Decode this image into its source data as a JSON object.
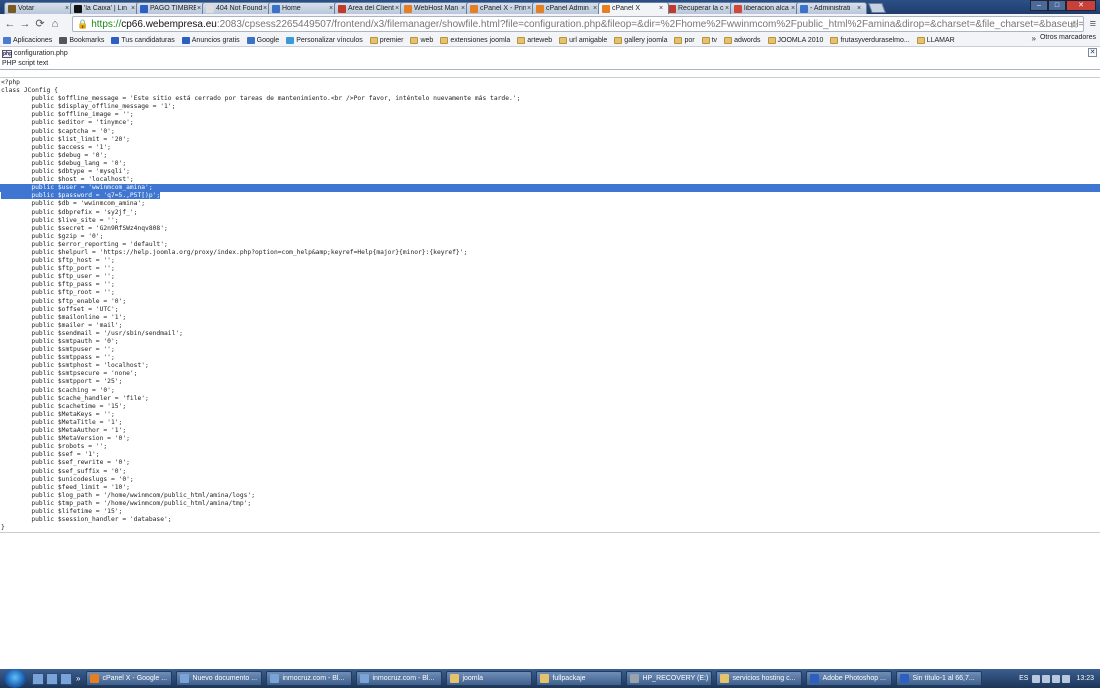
{
  "tabs": [
    {
      "label": "Votar",
      "icon_color": "#7a5a20",
      "active": false
    },
    {
      "label": "'la Caixa' | Lin",
      "icon_color": "#111111",
      "active": false
    },
    {
      "label": "PAGO TIMBRE",
      "icon_color": "#2b5fc2",
      "active": false
    },
    {
      "label": "404 Not Found",
      "icon_color": "#dddddd",
      "active": false
    },
    {
      "label": "Home",
      "icon_color": "#3a72c8",
      "active": false
    },
    {
      "label": "Área del Client",
      "icon_color": "#c0392b",
      "active": false
    },
    {
      "label": "WebHost Man",
      "icon_color": "#e67e22",
      "active": false
    },
    {
      "label": "cPanel X - Prin",
      "icon_color": "#e67e22",
      "active": false
    },
    {
      "label": "cPanel Admin",
      "icon_color": "#e67e22",
      "active": false
    },
    {
      "label": "cPanel X",
      "icon_color": "#e67e22",
      "active": true
    },
    {
      "label": "Recuperar la c",
      "icon_color": "#c0392b",
      "active": false
    },
    {
      "label": "liberacion alca",
      "icon_color": "#d44638",
      "active": false
    },
    {
      "label": "- Administrati",
      "icon_color": "#3a72c8",
      "active": false
    }
  ],
  "address": {
    "scheme": "https://",
    "host": "cp66.webempresa.eu",
    "rest": ":2083/cpsess2265449507/frontend/x3/filemanager/showfile.html?file=configuration.php&fileop=&dir=%2Fhome%2Fwwinmcom%2Fpublic_html%2Famina&dirop=&charset=&file_charset=&baseurl=&basedir="
  },
  "bookmarks": [
    {
      "label": "Aplicaciones",
      "icon": "apps-icon",
      "color": "#4a7bd0"
    },
    {
      "label": "Bookmarks",
      "icon": "star-icon",
      "color": "#555555"
    },
    {
      "label": "Tus candidaturas",
      "icon": "site-icon",
      "color": "#2b5fc2"
    },
    {
      "label": "Anuncios gratis",
      "icon": "site-icon",
      "color": "#2b5fc2"
    },
    {
      "label": "Google",
      "icon": "google-icon",
      "color": "#3a72c8"
    },
    {
      "label": "Personalizar vínculos",
      "icon": "grid-icon",
      "color": "#3a9ad9"
    },
    {
      "label": "premier",
      "icon": "folder-icon"
    },
    {
      "label": "web",
      "icon": "folder-icon"
    },
    {
      "label": "extensiones joomla",
      "icon": "folder-icon"
    },
    {
      "label": "arteweb",
      "icon": "folder-icon"
    },
    {
      "label": "url amigable",
      "icon": "folder-icon"
    },
    {
      "label": "gallery joomla",
      "icon": "folder-icon"
    },
    {
      "label": "por",
      "icon": "folder-icon"
    },
    {
      "label": "tv",
      "icon": "folder-icon"
    },
    {
      "label": "adwords",
      "icon": "folder-icon"
    },
    {
      "label": "JOOMLA 2010",
      "icon": "folder-icon"
    },
    {
      "label": "frutasyverduraselmo...",
      "icon": "folder-icon"
    },
    {
      "label": "LLAMAR",
      "icon": "folder-icon"
    }
  ],
  "bookmarks_more": "»",
  "bookmarks_other": "Otros marcadores",
  "file": {
    "name": "configuration.php",
    "type": "PHP script text"
  },
  "code_lines": [
    {
      "t": "<?php",
      "hl": "none"
    },
    {
      "t": "class JConfig {",
      "hl": "none"
    },
    {
      "t": "\tpublic $offline_message = 'Este sitio está cerrado por tareas de mantenimiento.<br />Por favor, inténtelo nuevamente más tarde.';",
      "hl": "none"
    },
    {
      "t": "\tpublic $display_offline_message = '1';",
      "hl": "none"
    },
    {
      "t": "\tpublic $offline_image = '';",
      "hl": "none"
    },
    {
      "t": "\tpublic $editor = 'tinymce';",
      "hl": "none"
    },
    {
      "t": "\tpublic $captcha = '0';",
      "hl": "none"
    },
    {
      "t": "\tpublic $list_limit = '20';",
      "hl": "none"
    },
    {
      "t": "\tpublic $access = '1';",
      "hl": "none"
    },
    {
      "t": "\tpublic $debug = '0';",
      "hl": "none"
    },
    {
      "t": "\tpublic $debug_lang = '0';",
      "hl": "none"
    },
    {
      "t": "\tpublic $dbtype = 'mysqli';",
      "hl": "none"
    },
    {
      "t": "\tpublic $host = 'localhost';",
      "hl": "none"
    },
    {
      "t": "\tpublic $user = 'wwinmcom_amina';",
      "hl": "full"
    },
    {
      "t": "\tpublic $password = 'q7=5.,P5T[)p';",
      "hl": "part"
    },
    {
      "t": "\tpublic $db = 'wwinmcom_amina';",
      "hl": "none"
    },
    {
      "t": "\tpublic $dbprefix = 'sy2jf_';",
      "hl": "none"
    },
    {
      "t": "\tpublic $live_site = '';",
      "hl": "none"
    },
    {
      "t": "\tpublic $secret = 'G2n9RfSWz4nqv808';",
      "hl": "none"
    },
    {
      "t": "\tpublic $gzip = '0';",
      "hl": "none"
    },
    {
      "t": "\tpublic $error_reporting = 'default';",
      "hl": "none"
    },
    {
      "t": "\tpublic $helpurl = 'https://help.joomla.org/proxy/index.php?option=com_help&amp;keyref=Help{major}{minor}:{keyref}';",
      "hl": "none"
    },
    {
      "t": "\tpublic $ftp_host = '';",
      "hl": "none"
    },
    {
      "t": "\tpublic $ftp_port = '';",
      "hl": "none"
    },
    {
      "t": "\tpublic $ftp_user = '';",
      "hl": "none"
    },
    {
      "t": "\tpublic $ftp_pass = '';",
      "hl": "none"
    },
    {
      "t": "\tpublic $ftp_root = '';",
      "hl": "none"
    },
    {
      "t": "\tpublic $ftp_enable = '0';",
      "hl": "none"
    },
    {
      "t": "\tpublic $offset = 'UTC';",
      "hl": "none"
    },
    {
      "t": "\tpublic $mailonline = '1';",
      "hl": "none"
    },
    {
      "t": "\tpublic $mailer = 'mail';",
      "hl": "none"
    },
    {
      "t": "\tpublic $sendmail = '/usr/sbin/sendmail';",
      "hl": "none"
    },
    {
      "t": "\tpublic $smtpauth = '0';",
      "hl": "none"
    },
    {
      "t": "\tpublic $smtpuser = '';",
      "hl": "none"
    },
    {
      "t": "\tpublic $smtppass = '';",
      "hl": "none"
    },
    {
      "t": "\tpublic $smtphost = 'localhost';",
      "hl": "none"
    },
    {
      "t": "\tpublic $smtpsecure = 'none';",
      "hl": "none"
    },
    {
      "t": "\tpublic $smtpport = '25';",
      "hl": "none"
    },
    {
      "t": "\tpublic $caching = '0';",
      "hl": "none"
    },
    {
      "t": "\tpublic $cache_handler = 'file';",
      "hl": "none"
    },
    {
      "t": "\tpublic $cachetime = '15';",
      "hl": "none"
    },
    {
      "t": "\tpublic $MetaKeys = '';",
      "hl": "none"
    },
    {
      "t": "\tpublic $MetaTitle = '1';",
      "hl": "none"
    },
    {
      "t": "\tpublic $MetaAuthor = '1';",
      "hl": "none"
    },
    {
      "t": "\tpublic $MetaVersion = '0';",
      "hl": "none"
    },
    {
      "t": "\tpublic $robots = '';",
      "hl": "none"
    },
    {
      "t": "\tpublic $sef = '1';",
      "hl": "none"
    },
    {
      "t": "\tpublic $sef_rewrite = '0';",
      "hl": "none"
    },
    {
      "t": "\tpublic $sef_suffix = '0';",
      "hl": "none"
    },
    {
      "t": "\tpublic $unicodeslugs = '0';",
      "hl": "none"
    },
    {
      "t": "\tpublic $feed_limit = '10';",
      "hl": "none"
    },
    {
      "t": "\tpublic $log_path = '/home/wwinmcom/public_html/amina/logs';",
      "hl": "none"
    },
    {
      "t": "\tpublic $tmp_path = '/home/wwinmcom/public_html/amina/tmp';",
      "hl": "none"
    },
    {
      "t": "\tpublic $lifetime = '15';",
      "hl": "none"
    },
    {
      "t": "\tpublic $session_handler = 'database';",
      "hl": "none"
    },
    {
      "t": "}",
      "hl": "none"
    }
  ],
  "taskbar": [
    {
      "label": "cPanel X - Google ...",
      "color": "#e67e22"
    },
    {
      "label": "Nuevo documento ...",
      "color": "#7aa3d8"
    },
    {
      "label": "inmocruz.com - Bl...",
      "color": "#7aa3d8"
    },
    {
      "label": "inmocruz.com - Bl...",
      "color": "#7aa3d8"
    },
    {
      "label": "joomla",
      "color": "#e5c36a"
    },
    {
      "label": "fullpackaje",
      "color": "#e5c36a"
    },
    {
      "label": "HP_RECOVERY (E:)",
      "color": "#9aa3ad"
    },
    {
      "label": "servicios hosting c...",
      "color": "#e5c36a"
    },
    {
      "label": "Adobe Photoshop ...",
      "color": "#2b5fc2"
    },
    {
      "label": "Sin título-1 al 66,7...",
      "color": "#2b5fc2"
    }
  ],
  "tray": {
    "lang": "ES",
    "time": "13:23"
  }
}
